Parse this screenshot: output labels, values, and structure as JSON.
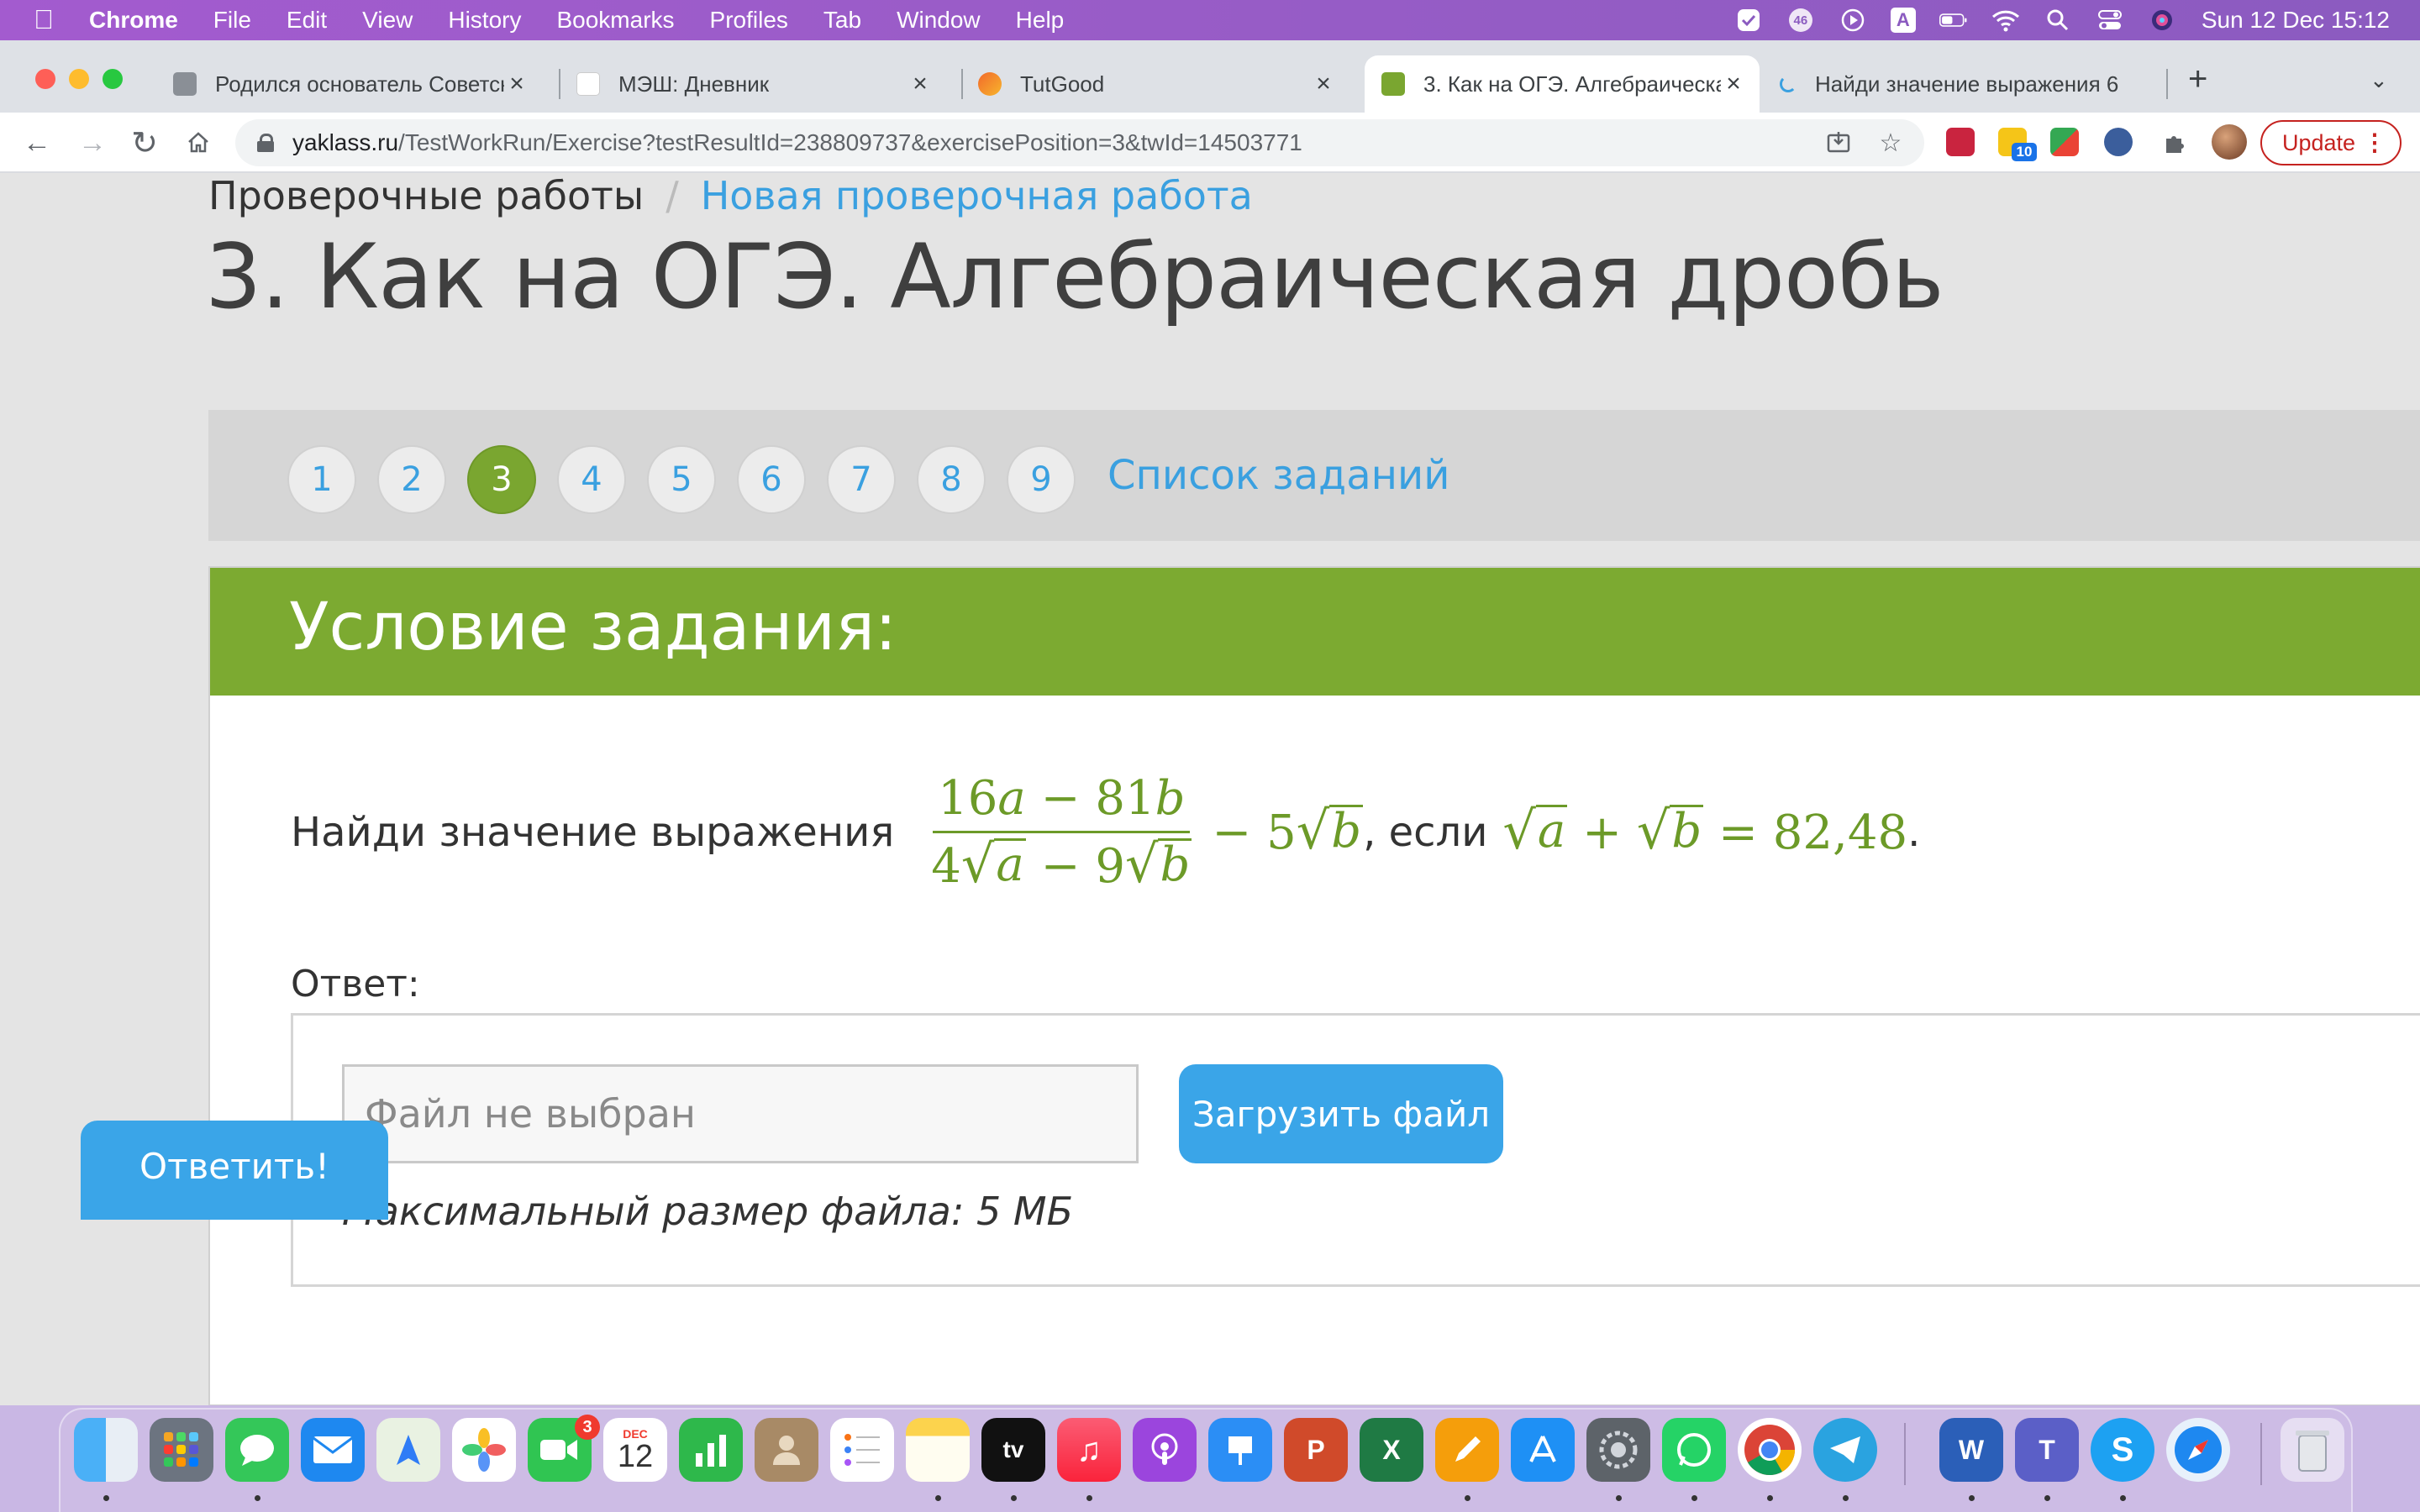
{
  "menubar": {
    "app": "Chrome",
    "menus": [
      "File",
      "Edit",
      "View",
      "History",
      "Bookmarks",
      "Profiles",
      "Tab",
      "Window",
      "Help"
    ],
    "notification_count": "46",
    "input_source": "A",
    "clock": "Sun 12 Dec  15:12"
  },
  "tabs": [
    {
      "title": "Родился основатель Советск",
      "favicon_color": "#8a8f96"
    },
    {
      "title": "МЭШ: Дневник",
      "favicon_color": "#ffffff"
    },
    {
      "title": "TutGood",
      "favicon_color": "#f2692b"
    },
    {
      "title": "3. Как на ОГЭ. Алгебраическа",
      "favicon_color": "#7aa630",
      "active": true
    },
    {
      "title": "Найди значение выражения 6",
      "favicon_color": "#3aa0e0"
    }
  ],
  "toolbar": {
    "url_host": "yaklass.ru",
    "url_path": "/TestWorkRun/Exercise?testResultId=238809737&exercisePosition=3&twId=14503771",
    "update_label": "Update",
    "extension_badge": "10"
  },
  "breadcrumbs": {
    "first": "Проверочные работы",
    "separator": "/",
    "second": "Новая проверочная работа"
  },
  "page_title": "3. Как на ОГЭ. Алгебраическая дробь",
  "question_nav": {
    "numbers": [
      "1",
      "2",
      "3",
      "4",
      "5",
      "6",
      "7",
      "8",
      "9"
    ],
    "current": "3",
    "list_link": "Список заданий"
  },
  "task": {
    "header": "Условие задания:",
    "prompt": "Найди значение выражения",
    "numerator": {
      "c1": "16",
      "v1": "a",
      "op": "−",
      "c2": "81",
      "v2": "b"
    },
    "denominator": {
      "c1": "4",
      "v1": "a",
      "op": "−",
      "c2": "9",
      "v2": "b"
    },
    "tail": {
      "op": "−",
      "c": "5",
      "v": "b"
    },
    "condition_word": ", если",
    "condition": {
      "v1": "a",
      "op": "+",
      "v2": "b",
      "eq": "=",
      "value": "82,48",
      "end": "."
    }
  },
  "answer": {
    "label": "Ответ:",
    "file_placeholder": "Файл не выбран",
    "upload_label": "Загрузить файл",
    "max_size": "Максимальный размер файла: 5 МБ",
    "submit_label": "Ответить!"
  },
  "dock": {
    "calendar_month": "DEC",
    "calendar_day": "12",
    "facetime_badge": "3",
    "tv_label": "tv"
  },
  "colors": {
    "accent_green": "#7caa31",
    "link_blue": "#3aa0e0",
    "button_blue": "#3aa5e8",
    "math_green": "#6c9a28"
  }
}
